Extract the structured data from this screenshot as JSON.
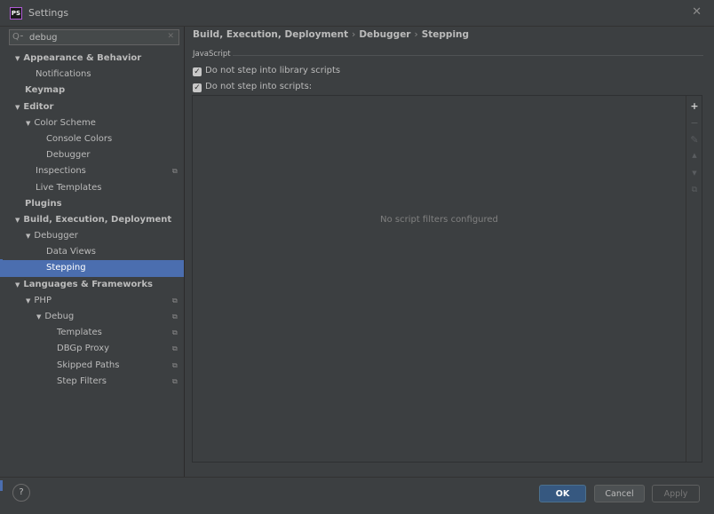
{
  "window": {
    "app_icon": "PS",
    "title": "Settings",
    "close_glyph": "✕"
  },
  "search": {
    "value": "debug",
    "icon": "search-icon",
    "clear_glyph": "✕"
  },
  "tree": [
    {
      "label": "Appearance & Behavior",
      "expanded": true,
      "bold": true
    },
    {
      "label": "Notifications"
    },
    {
      "label": "Keymap",
      "bold": true
    },
    {
      "label": "Editor",
      "expanded": true,
      "bold": true
    },
    {
      "label": "Color Scheme",
      "expanded": true
    },
    {
      "label": "Console Colors"
    },
    {
      "label": "Debugger"
    },
    {
      "label": "Inspections",
      "project_icon": true
    },
    {
      "label": "Live Templates"
    },
    {
      "label": "Plugins",
      "bold": true
    },
    {
      "label": "Build, Execution, Deployment",
      "expanded": true,
      "bold": true
    },
    {
      "label": "Debugger",
      "expanded": true
    },
    {
      "label": "Data Views"
    },
    {
      "label": "Stepping",
      "selected": true
    },
    {
      "label": "Languages & Frameworks",
      "expanded": true,
      "bold": true
    },
    {
      "label": "PHP",
      "expanded": true,
      "project_icon": true
    },
    {
      "label": "Debug",
      "expanded": true,
      "project_icon": true
    },
    {
      "label": "Templates",
      "project_icon": true
    },
    {
      "label": "DBGp Proxy",
      "project_icon": true
    },
    {
      "label": "Skipped Paths",
      "project_icon": true
    },
    {
      "label": "Step Filters",
      "project_icon": true
    }
  ],
  "breadcrumb": [
    "Build, Execution, Deployment",
    "Debugger",
    "Stepping"
  ],
  "breadcrumb_separator": "›",
  "section": {
    "title": "JavaScript",
    "options": [
      {
        "label": "Do not step into library scripts",
        "checked": true
      },
      {
        "label": "Do not step into scripts:",
        "checked": true
      }
    ]
  },
  "filters": {
    "empty_text": "No script filters configured",
    "toolbar": [
      {
        "icon": "add-icon",
        "glyph": "+",
        "enabled": true
      },
      {
        "icon": "remove-icon",
        "glyph": "−",
        "enabled": false
      },
      {
        "icon": "edit-icon",
        "glyph": "✎",
        "enabled": false
      },
      {
        "icon": "move-up-icon",
        "glyph": "▲",
        "enabled": false
      },
      {
        "icon": "move-down-icon",
        "glyph": "▼",
        "enabled": false
      },
      {
        "icon": "copy-icon",
        "glyph": "⧉",
        "enabled": false
      }
    ]
  },
  "footer": {
    "help_glyph": "?",
    "ok": "OK",
    "cancel": "Cancel",
    "apply": "Apply"
  },
  "colors": {
    "background": "#3c3f41",
    "selection": "#4b6eaf",
    "primary_button": "#365880"
  }
}
